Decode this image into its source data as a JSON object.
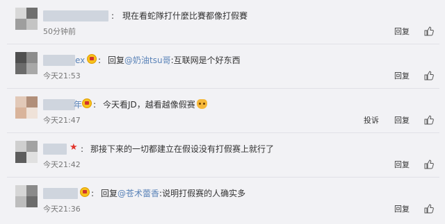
{
  "comments": [
    {
      "name_tail": "",
      "has_crown": false,
      "has_star": false,
      "reply_prefix": "",
      "mention": "",
      "text": "現在看蛇隊打什麼比賽都像打假賽",
      "emoji": false,
      "time": "50分钟前",
      "report": "",
      "reply": "回复",
      "like_icon": "thumbs-up-icon"
    },
    {
      "name_tail": "ex",
      "has_crown": true,
      "has_star": false,
      "reply_prefix": "回复",
      "mention": "@奶油tsu哥",
      "text": ":互联网是个好东西",
      "emoji": false,
      "time": "今天21:53",
      "report": "",
      "reply": "回复",
      "like_icon": "thumbs-up-icon"
    },
    {
      "name_tail": "年",
      "has_crown": true,
      "has_star": false,
      "reply_prefix": "",
      "mention": "",
      "text": "今天看JD，越看越像假赛",
      "emoji": true,
      "time": "今天21:47",
      "report": "投诉",
      "reply": "回复",
      "like_icon": "thumbs-up-icon"
    },
    {
      "name_tail": "",
      "has_crown": false,
      "has_star": true,
      "reply_prefix": "",
      "mention": "",
      "text": "那接下来的一切都建立在假设没有打假赛上就行了",
      "emoji": false,
      "time": "今天21:42",
      "report": "",
      "reply": "回复",
      "like_icon": "thumbs-up-icon"
    },
    {
      "name_tail": "",
      "has_crown": true,
      "has_star": false,
      "reply_prefix": "回复",
      "mention": "@苍术蕾香",
      "text": ":说明打假赛的人确实多",
      "emoji": false,
      "time": "今天21:36",
      "report": "",
      "reply": "回复",
      "like_icon": "thumbs-up-icon"
    }
  ],
  "colors": {
    "background": "#f2f2f5",
    "link": "#5a83b8",
    "text": "#333333",
    "star": "#e2342b"
  }
}
